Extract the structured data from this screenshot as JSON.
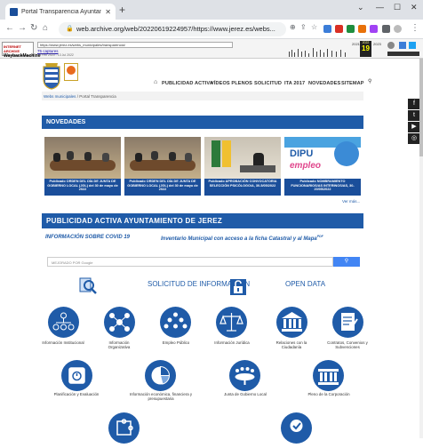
{
  "browser": {
    "tab_title": "Portal Transparencia Ayuntamien",
    "url": "web.archive.org/web/20220619224957/https://www.jerez.es/webs...",
    "wayback_date_label": "19",
    "wayback_year_left": "2021",
    "wayback_year_mid": "2022",
    "wayback_year_right": "2023",
    "wayback_captures": "75 captures",
    "wayback_capture_range": "19 Feb 2020 - 13 Jul 2022"
  },
  "site": {
    "nav": [
      "PUBLICIDAD ACTIVA",
      "VÍDEOS PLENOS",
      "SOLICITUD",
      "ITA 2017",
      "NOVEDADES",
      "SITEMAP"
    ],
    "breadcrumb": [
      "Webs municipales",
      "Portal Transparencia"
    ],
    "novedades_title": "NOVEDADES",
    "news": [
      {
        "caption": "Publicado ORDEN DEL DÍA DE JUNTA DE GOBIERNO LOCAL (JGL) del 30 de mayo de 2022"
      },
      {
        "caption": "Publicado ORDEN DEL DÍA DE JUNTA DE GOBIERNO LOCAL (JGL) del 30 de mayo de 2022"
      },
      {
        "caption": "Publicado APROBACIÓN CONVOCATORIA SELECCIÓN PSICÓLOGO/A, 30-5/05/2022"
      },
      {
        "caption": "Publicado NOMBRAMIENTO FUNCIONARIOS/AS INTERINOS/AS, 30-20/05/2022"
      }
    ],
    "dipu_text": "DIPU",
    "empleo_text": "empleo",
    "ver_mas": "Ver más...",
    "publicidad_title": "PUBLICIDAD ACTIVA AYUNTAMIENTO DE JEREZ",
    "link_covid": "INFORMACIÓN SOBRE COVID 19",
    "link_inventario": "Inventario Municipal con acceso a la ficha Catastral y al Mapa",
    "link_inventario_sup": "PDF",
    "search_placeholder": "MEJORADO POR Google",
    "solicitud_label": "SOLICITUD DE INFORMACIÓN",
    "open_data_label": "OPEN DATA",
    "categories_row1": [
      "Información Institucional",
      "Información Organizativa",
      "Empleo Público",
      "Información Jurídica",
      "Relaciones con la Ciudadanía",
      "Contratos, Convenios y Subvenciones"
    ],
    "categories_row2": [
      "Planificación y Evaluación",
      "Información económica, financiera y presupuestaria",
      "Junta de Gobierno Local",
      "Pleno de la Corporación"
    ],
    "social": [
      "f",
      "t",
      "yt",
      "ig"
    ]
  }
}
